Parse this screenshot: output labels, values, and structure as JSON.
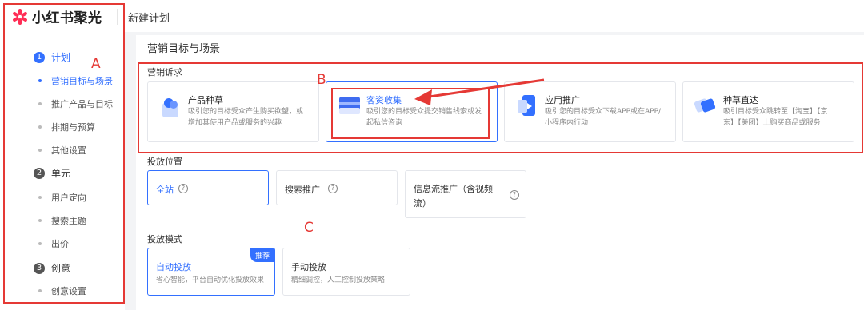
{
  "brand": {
    "name": "小红书聚光"
  },
  "header": {
    "title": "新建计划"
  },
  "sidebar": {
    "groups": [
      {
        "num": "1",
        "label": "计划",
        "items": [
          "营销目标与场景",
          "推广产品与目标",
          "排期与预算",
          "其他设置"
        ]
      },
      {
        "num": "2",
        "label": "单元",
        "items": [
          "用户定向",
          "搜索主题",
          "出价"
        ]
      },
      {
        "num": "3",
        "label": "创意",
        "items": [
          "创意设置"
        ]
      }
    ]
  },
  "main": {
    "section_title": "营销目标与场景",
    "appeal": {
      "title": "营销诉求",
      "cards": [
        {
          "title": "产品种草",
          "desc1": "吸引您的目标受众产生购买欲望，或",
          "desc2": "增加其使用产品或服务的兴趣"
        },
        {
          "title": "客资收集",
          "desc1": "吸引您的目标受众提交销售线索或发",
          "desc2": "起私信咨询"
        },
        {
          "title": "应用推广",
          "desc1": "吸引您的目标受众下载APP或在APP/",
          "desc2": "小程序内行动"
        },
        {
          "title": "种草直达",
          "desc1": "吸引目标受众跳转至【淘宝】【京",
          "desc2": "东】【美团】上购买商品或服务"
        }
      ]
    },
    "placement": {
      "title": "投放位置",
      "options": [
        "全站",
        "搜索推广",
        "信息流推广（含视频",
        "流）"
      ]
    },
    "mode": {
      "title": "投放模式",
      "options": [
        {
          "title": "自动投放",
          "badge": "推荐",
          "desc": "省心智能，平台自动优化投放效果"
        },
        {
          "title": "手动投放",
          "desc": "精细调控，人工控制投放策略"
        }
      ]
    }
  },
  "annotations": {
    "a": "A",
    "b": "B",
    "c": "C"
  },
  "colors": {
    "accent": "#3370ff",
    "annotation": "#e53935"
  }
}
